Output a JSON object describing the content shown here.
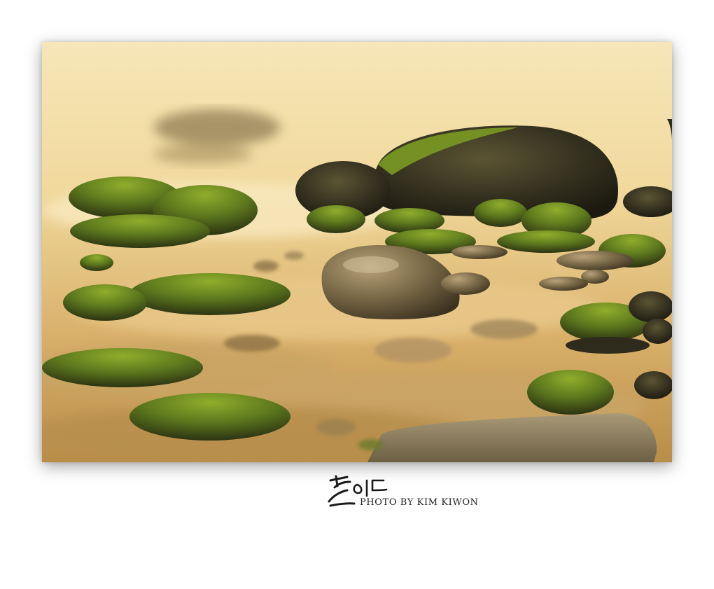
{
  "photo": {
    "subject": "mossy-stones-long-exposure",
    "palette": {
      "mist_light": "#f7e9c0",
      "mist_mid": "#e8c98a",
      "mist_warm": "#d6a860",
      "stone_dark": "#2e2a1c",
      "stone_mid": "#5a5232",
      "moss": "#6d8a22",
      "moss_bright": "#8fae2c",
      "frame_shadow": "#000000",
      "background": "#ffffff"
    }
  },
  "credit": {
    "signature": "손이",
    "text": "PHOTO BY KIM KIWON"
  }
}
